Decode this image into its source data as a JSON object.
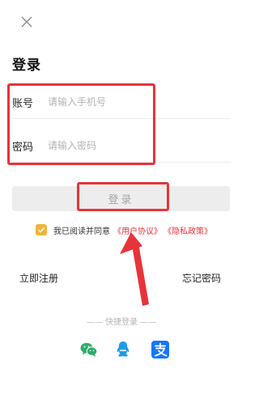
{
  "page": {
    "title": "登录"
  },
  "form": {
    "account_label": "账号",
    "account_placeholder": "请输入手机号",
    "password_label": "密码",
    "password_placeholder": "请输入密码",
    "login_label": "登录"
  },
  "agreement": {
    "checked": true,
    "text": "我已阅读并同意",
    "user_agreement": "《用户协议》",
    "privacy_policy": "《隐私政策》"
  },
  "links": {
    "register": "立即注册",
    "forgot_password": "忘记密码"
  },
  "quick_login": {
    "label": "—— 快捷登录 ——",
    "providers": [
      "wechat-icon",
      "qq-icon",
      "alipay-icon"
    ]
  },
  "colors": {
    "highlight": "#e8333a",
    "checkbox": "#f0b33a",
    "wechat": "#2aae67",
    "qq": "#1e9be8",
    "alipay": "#1677ff"
  }
}
